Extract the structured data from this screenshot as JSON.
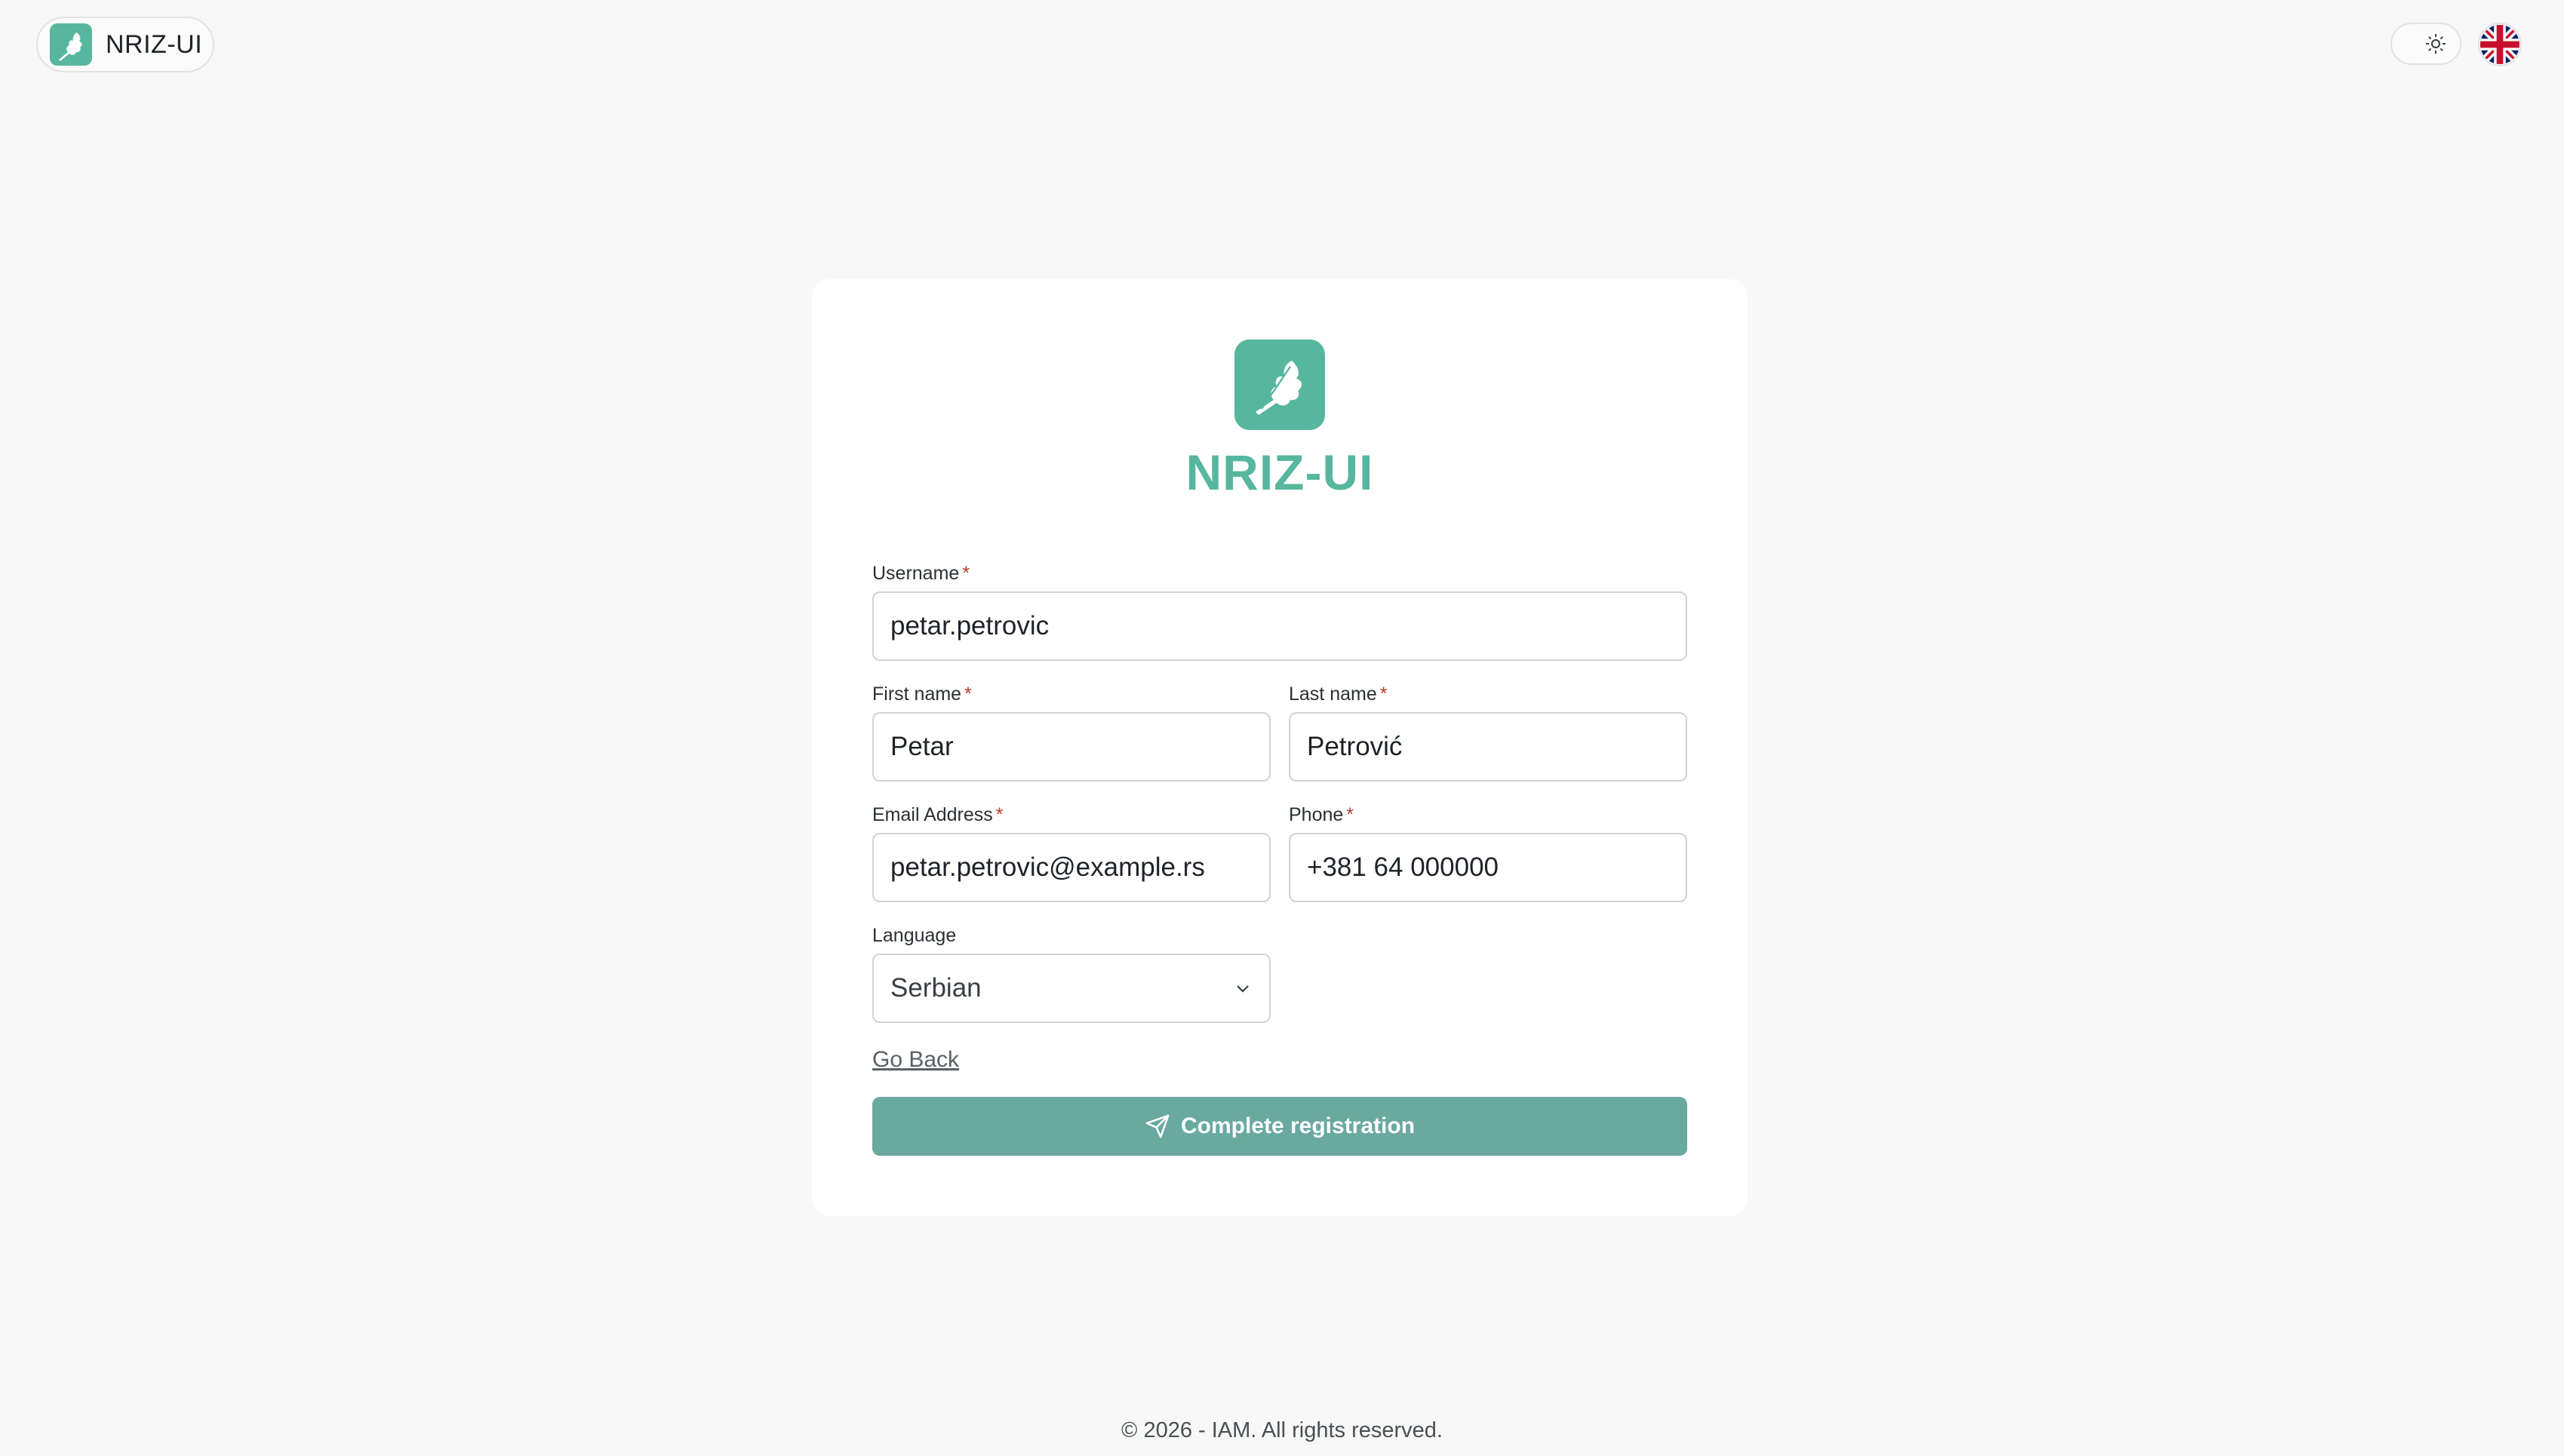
{
  "header": {
    "brand": "NRIZ-UI",
    "theme_toggle_icon": "sun-icon",
    "language_icon": "uk-flag-icon"
  },
  "card": {
    "title": "NRIZ-UI",
    "logo_icon": "oak-leaf-icon",
    "fields": {
      "username": {
        "label": "Username",
        "required": "*",
        "value": "petar.petrovic"
      },
      "first_name": {
        "label": "First name",
        "required": "*",
        "value": "Petar"
      },
      "last_name": {
        "label": "Last name",
        "required": "*",
        "value": "Petrović"
      },
      "email": {
        "label": "Email Address",
        "required": "*",
        "value": "petar.petrovic@example.rs"
      },
      "phone": {
        "label": "Phone",
        "required": "*",
        "value": "+381 64 000000"
      },
      "language": {
        "label": "Language",
        "value": "Serbian"
      }
    },
    "go_back": "Go Back",
    "submit": "Complete registration"
  },
  "footer": {
    "text": "© 2026 - IAM. All rights reserved."
  },
  "colors": {
    "brand": "#57b79e",
    "button": "#69a99f",
    "required": "#c0392b",
    "background": "#f8f8f8"
  }
}
